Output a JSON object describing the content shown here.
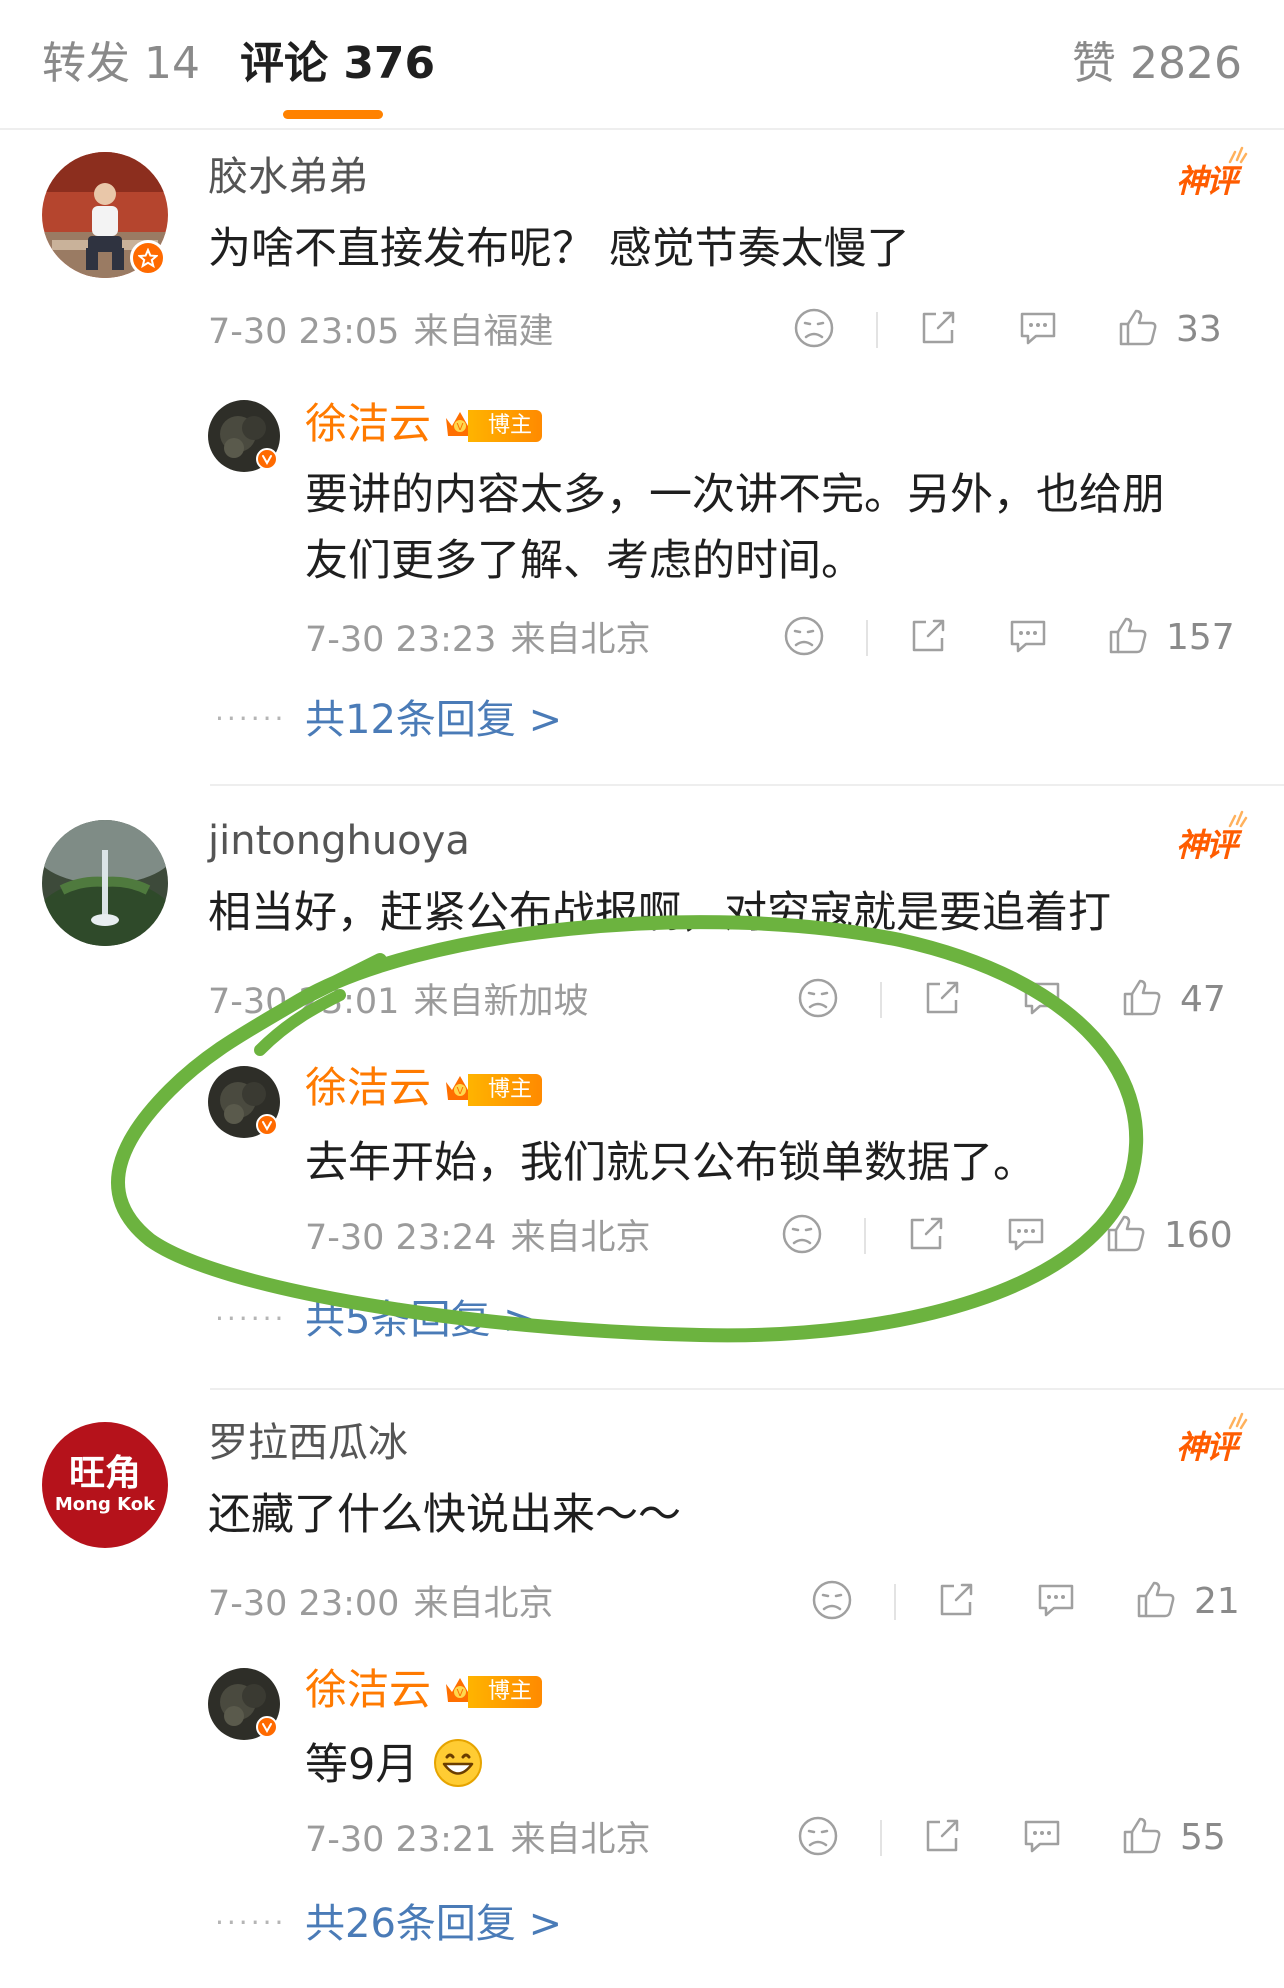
{
  "tabs": {
    "reposts": "转发 14",
    "comments": "评论 376",
    "likes": "赞 2826"
  },
  "hot_badge": "神评",
  "blogger_badge": "博主",
  "comments": [
    {
      "username": "胶水弟弟",
      "text": "为啥不直接发布呢？  感觉节奏太慢了",
      "time": "7-30 23:05",
      "location": "来自福建",
      "likes": "33",
      "reply": {
        "username": "徐洁云",
        "text_line1": "要讲的内容太多，一次讲不完。另外，也给朋",
        "text_line2": "友们更多了解、考虑的时间。",
        "time": "7-30 23:23",
        "location": "来自北京",
        "likes": "157"
      },
      "more_replies": "共12条回复 >"
    },
    {
      "username": "jintonghuoya",
      "text": "相当好，赶紧公布战报啊，对穷寇就是要追着打",
      "time": "7-30 23:01",
      "location": "来自新加坡",
      "likes": "47",
      "reply": {
        "username": "徐洁云",
        "text_line1": "去年开始，我们就只公布锁单数据了。",
        "time": "7-30 23:24",
        "location": "来自北京",
        "likes": "160"
      },
      "more_replies": "共5条回复 >"
    },
    {
      "username": "罗拉西瓜冰",
      "text": "还藏了什么快说出来～～",
      "time": "7-30 23:00",
      "location": "来自北京",
      "likes": "21",
      "avatar_text_top": "旺角",
      "avatar_text_bottom": "Mong Kok",
      "reply": {
        "username": "徐洁云",
        "text_line1": "等9月",
        "time": "7-30 23:21",
        "location": "来自北京",
        "likes": "55"
      },
      "more_replies": "共26条回复 >"
    }
  ],
  "colors": {
    "accent": "#ff8200",
    "reply_name": "#ff7a00",
    "link": "#4a7bb7",
    "annotation": "#6cb33f"
  }
}
